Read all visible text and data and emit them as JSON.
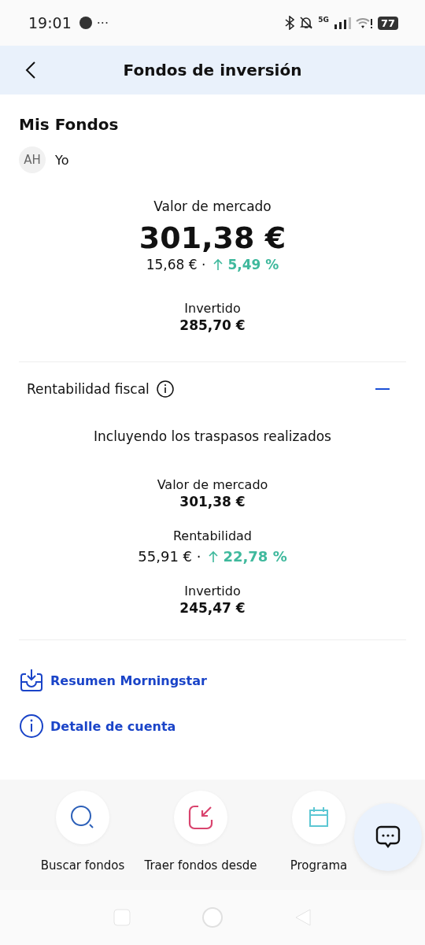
{
  "status_bar": {
    "time": "19:01",
    "more": "···",
    "network": "5G",
    "battery": "77"
  },
  "header": {
    "title": "Fondos de inversión"
  },
  "section_title": "Mis Fondos",
  "owner": {
    "initials": "AH",
    "name": "Yo"
  },
  "summary": {
    "label": "Valor de mercado",
    "value": "301,38 €",
    "gain": "15,68 € ·",
    "gain_pct": "5,49 %",
    "invested_label": "Invertido",
    "invested": "285,70 €"
  },
  "fiscal": {
    "title": "Rentabilidad fiscal",
    "expanded": true,
    "subtitle": "Incluyendo los traspasos realizados",
    "stats": [
      {
        "label": "Valor de mercado",
        "value": "301,38 €"
      },
      {
        "label": "Rentabilidad",
        "value": "55,91 € ·",
        "pct": "22,78 %"
      },
      {
        "label": "Invertido",
        "value": "245,47 €"
      }
    ]
  },
  "links": [
    {
      "kind": "download",
      "label": "Resumen Morningstar"
    },
    {
      "kind": "info",
      "label": "Detalle de cuenta"
    }
  ],
  "actions": [
    {
      "kind": "search",
      "label": "Buscar fondos"
    },
    {
      "kind": "import",
      "label": "Traer fondos desde"
    },
    {
      "kind": "calendar",
      "label": "Programa"
    }
  ]
}
